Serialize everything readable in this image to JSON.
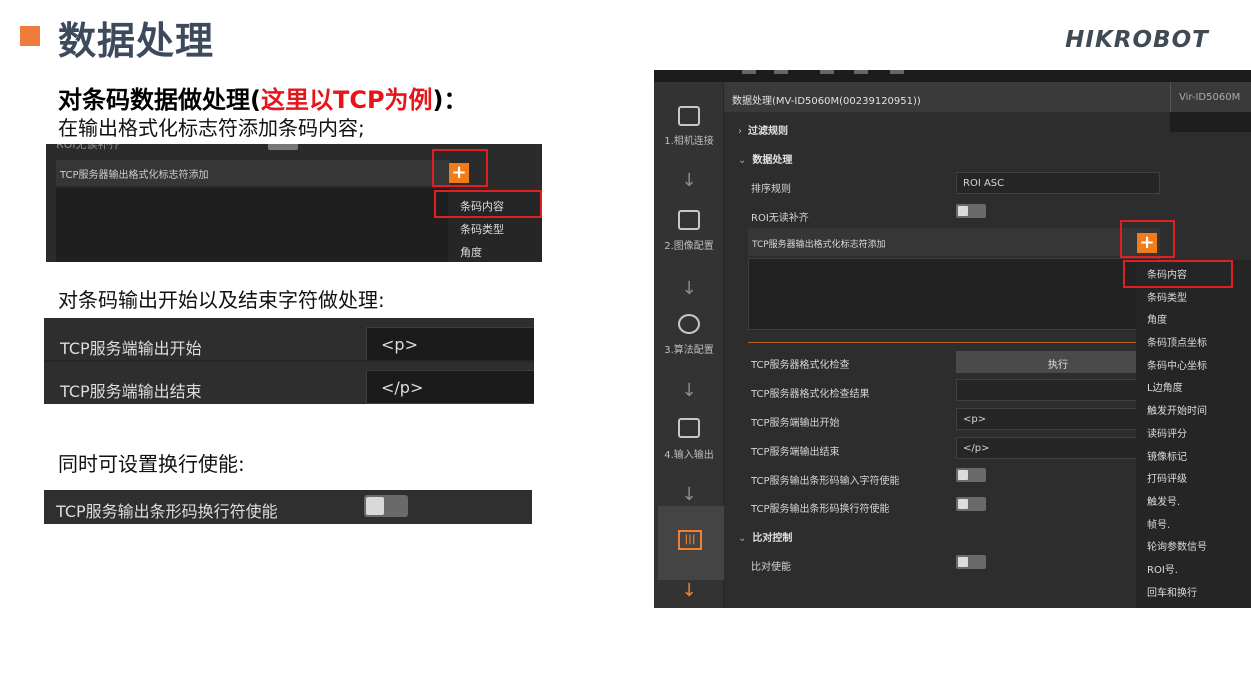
{
  "header": {
    "title": "数据处理",
    "logo": "HIKROBOT",
    "accent": "#f07c3c"
  },
  "left": {
    "heading_prefix": "对条码数据做处理(",
    "heading_highlight": "这里以TCP为例",
    "heading_suffix": ")：",
    "sub1": "在输出格式化标志符添加条码内容;",
    "sub2": "对条码输出开始以及结束字符做处理:",
    "sub3": "同时可设置换行使能:"
  },
  "shot1": {
    "cut_label": "ROI无读补齐",
    "row_label": "TCP服务器输出格式化标志符添加",
    "plus": "+",
    "menu": [
      "条码内容",
      "条码类型",
      "角度"
    ]
  },
  "shot2": {
    "rows": [
      {
        "label": "TCP服务端输出开始",
        "value": "<p>"
      },
      {
        "label": "TCP服务端输出结束",
        "value": "</p>"
      }
    ]
  },
  "shot3": {
    "label": "TCP服务输出条形码换行符使能"
  },
  "app": {
    "panel_title": "数据处理(MV-ID5060M(00239120951))",
    "tab2": "Vir-ID5060M",
    "sidebar": [
      {
        "label": "1.相机连接",
        "icon": "camera-link-icon"
      },
      {
        "label": "2.图像配置",
        "icon": "image-config-icon"
      },
      {
        "label": "3.算法配置",
        "icon": "algorithm-config-icon"
      },
      {
        "label": "4.输入输出",
        "icon": "io-icon"
      }
    ],
    "active_icon": "barcode-icon",
    "groups": {
      "filter": "过滤规则",
      "data": "数据处理",
      "compare": "比对控制"
    },
    "props": {
      "sort_label": "排序规则",
      "sort_value": "ROI ASC",
      "roi_fill": "ROI无读补齐",
      "tcp_format": "TCP服务器输出格式化标志符添加",
      "format_check": "TCP服务器格式化检查",
      "format_check_btn": "执行",
      "format_result": "TCP服务器格式化检查结果",
      "out_start": "TCP服务端输出开始",
      "out_start_value": "<p>",
      "out_end": "TCP服务端输出结束",
      "out_end_value": "</p>",
      "input_char": "TCP服务输出条形码输入字符使能",
      "newline": "TCP服务输出条形码换行符使能",
      "compare_enable": "比对使能"
    },
    "plus": "+",
    "menu": [
      "条码内容",
      "条码类型",
      "角度",
      "条码顶点坐标",
      "条码中心坐标",
      "L边角度",
      "触发开始时间",
      "读码评分",
      "镜像标记",
      "打码评级",
      "触发号.",
      "帧号.",
      "轮询参数信号",
      "ROI号.",
      "回车和换行"
    ]
  }
}
